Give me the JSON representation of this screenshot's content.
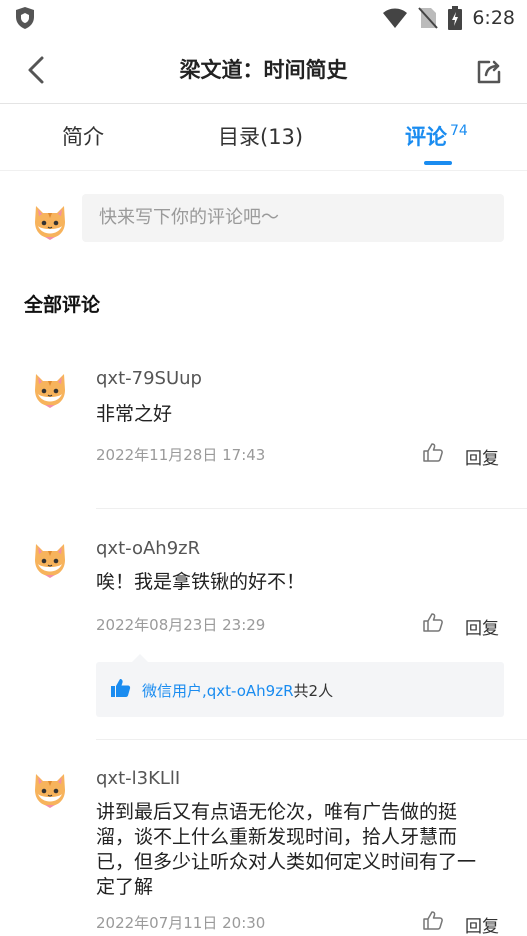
{
  "status_bar": {
    "time": "6:28"
  },
  "header": {
    "title": "梁文道：时间简史"
  },
  "tabs": [
    {
      "label": "简介"
    },
    {
      "label": "目录(13)"
    },
    {
      "label": "评论",
      "badge": "74"
    }
  ],
  "compose": {
    "placeholder": "快来写下你的评论吧～"
  },
  "section_title": "全部评论",
  "comments": [
    {
      "user": "qxt-79SUup",
      "text": "非常之好",
      "date": "2022年11月28日 17:43",
      "reply_label": "回复"
    },
    {
      "user": "qxt-oAh9zR",
      "text": "唉！我是拿铁锹的好不！",
      "date": "2022年08月23日 23:29",
      "reply_label": "回复",
      "likers": {
        "names": "微信用户,qxt-oAh9zR",
        "count_text": "共2人"
      }
    },
    {
      "user": "qxt-l3KLlI",
      "text": "讲到最后又有点语无伦次，唯有广告做的挺溜，谈不上什么重新发现时间，拾人牙慧而已，但多少让听众对人类如何定义时间有了一定了解",
      "date": "2022年07月11日 20:30",
      "reply_label": "回复"
    }
  ],
  "colors": {
    "accent": "#1a8cf0",
    "placeholder_bg": "#f4f4f4"
  },
  "icons": [
    "shield-icon",
    "wifi-icon",
    "no-sim-icon",
    "battery-icon",
    "back-arrow-icon",
    "share-icon",
    "thumb-up-icon",
    "cat-avatar-icon"
  ]
}
